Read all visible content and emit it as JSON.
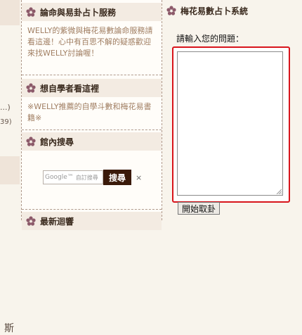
{
  "left_fragments": {
    "ellipsis": "...)",
    "count": "39)",
    "char": "斯"
  },
  "boxes": [
    {
      "title": "論命與易卦占卜服務",
      "body": "WELLY的紫微與梅花易數論命服務請看這邊！心中有百思不解的疑惑歡迎來找WELLY討論喔！"
    },
    {
      "title": "想自學者看這裡",
      "body": "※WELLY推薦的自學斗數和梅花易書籍※"
    },
    {
      "title": "館內搜尋"
    },
    {
      "title": "最新迴響"
    }
  ],
  "search": {
    "google_text": "Google™",
    "placeholder": "自訂搜尋",
    "button_label": "搜尋",
    "clear_label": "×"
  },
  "right_panel": {
    "title": "梅花易數占卜系統",
    "prompt_label": "請輸入您的問題：",
    "question_value": "",
    "submit_label": "開始取卦"
  },
  "colors": {
    "accent_red": "#d8141b",
    "header_bg": "#f3ebe2",
    "search_button_bg": "#3a1a0a"
  }
}
